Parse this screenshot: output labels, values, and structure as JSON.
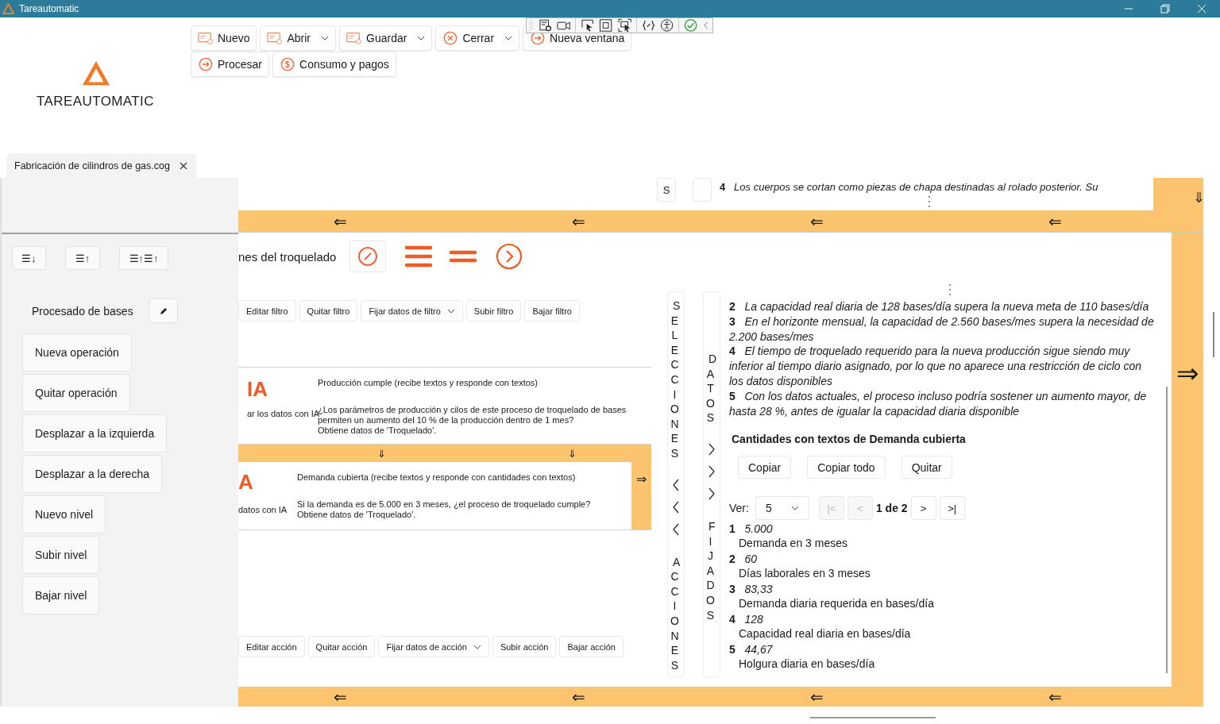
{
  "window": {
    "title": "Tareautomatic"
  },
  "logo": {
    "text": "TAREAUTOMATIC"
  },
  "toolbar": {
    "rows": [
      [
        {
          "label": "Nuevo",
          "dropdown": false
        },
        {
          "label": "Abrir",
          "dropdown": true
        },
        {
          "label": "Guardar",
          "dropdown": true
        },
        {
          "label": "Cerrar",
          "dropdown": true
        },
        {
          "label": "Nueva ventana",
          "dropdown": false
        }
      ],
      [
        {
          "label": "Procesar",
          "dropdown": false
        },
        {
          "label": "Consumo y pagos",
          "dropdown": false
        }
      ]
    ]
  },
  "document_tab": {
    "label": "Fabricación de cilindros de gas.cog"
  },
  "left_panel": {
    "sort_buttons": [
      "☰↓",
      "☰↑",
      "☰↑☰↑"
    ],
    "operation": "Procesado de bases",
    "buttons": [
      "Nueva operación",
      "Quitar operación",
      "Desplazar a la izquierda",
      "Desplazar a la derecha",
      "Nuevo nivel",
      "Subir nivel",
      "Bajar nivel"
    ]
  },
  "canvas": {
    "top_strip": {
      "button": "S",
      "number": "4",
      "text": "Los cuerpos se cortan como piezas de chapa destinadas al rolado posterior. Su",
      "arrow": "⇓"
    },
    "top_band": {
      "arrows": [
        "⇐",
        "⇐",
        "⇐",
        "⇐"
      ]
    },
    "process": {
      "title": "nes del troquelado"
    },
    "filter_buttons": [
      {
        "label": "Editar filtro",
        "dropdown": false
      },
      {
        "label": "Quitar filtro",
        "dropdown": false
      },
      {
        "label": "Fijar datos de filtro",
        "dropdown": true
      },
      {
        "label": "Subir filtro",
        "dropdown": false
      },
      {
        "label": "Bajar filtro",
        "dropdown": false
      }
    ],
    "cards": [
      {
        "badge": "IA",
        "caption": "ar los datos con IA",
        "title": "Producción cumple (recibe textos y responde con textos)",
        "question": "¿Los parámetros de producción y cilos de este proceso de troquelado de bases permiten un aumento del 10 % de la producción dentro de 1 mes?",
        "source": "Obtiene datos de 'Troquelado'."
      },
      {
        "badge": "A",
        "caption": "datos con IA",
        "title": "Demanda cubierta (recibe textos y responde con cantidades con textos)",
        "question": "Si la demanda es de 5.000 en 3 meses, ¿el proceso de troquelado cumple?",
        "source": "Obtiene datos de 'Troquelado'.",
        "side_arrow": "⇒"
      }
    ],
    "card_band": {
      "arrows": [
        "⇓",
        "⇓"
      ]
    },
    "action_buttons": [
      {
        "label": "Editar acción",
        "dropdown": false
      },
      {
        "label": "Quitar acción",
        "dropdown": false
      },
      {
        "label": "Fijar datos de acción",
        "dropdown": true
      },
      {
        "label": "Subir acción",
        "dropdown": false
      },
      {
        "label": "Bajar acción",
        "dropdown": false
      }
    ],
    "selections_strip": {
      "top": "SELECCIONES",
      "bottom": "ACCIONES"
    },
    "data_strip": {
      "top": "DATOS",
      "bottom": "FIJADOS"
    },
    "results": {
      "items": [
        {
          "number": "2",
          "text": "La capacidad real diaria de 128 bases/día supera la nueva meta de 110 bases/día"
        },
        {
          "number": "3",
          "text": "En el horizonte mensual, la capacidad de 2.560 bases/mes supera la necesidad de 2.200 bases/mes"
        },
        {
          "number": "4",
          "text": "El tiempo de troquelado requerido para la nueva producción sigue siendo muy inferior al tiempo diario asignado, por lo que no aparece una restricción de ciclo con los datos disponibles"
        },
        {
          "number": "5",
          "text": "Con los datos actuales, el proceso incluso podría sostener un aumento mayor, de hasta 28 %, antes de igualar la capacidad diaria disponible"
        }
      ],
      "heading": "Cantidades con textos  de Demanda cubierta",
      "buttons": [
        "Copiar",
        "Copiar todo",
        "Quitar"
      ],
      "pager": {
        "label": "Ver:",
        "page_size": "5",
        "page": "1 de 2",
        "buttons": [
          {
            "label": "|<",
            "disabled": true
          },
          {
            "label": "<",
            "disabled": true
          },
          {
            "label": ">",
            "disabled": false
          },
          {
            "label": ">|",
            "disabled": false
          }
        ]
      },
      "quantities": [
        {
          "number": "1",
          "value": "5.000",
          "label": "Demanda en 3 meses"
        },
        {
          "number": "2",
          "value": "60",
          "label": "Días laborales en 3 meses"
        },
        {
          "number": "3",
          "value": "83,33",
          "label": "Demanda diaria requerida en bases/día"
        },
        {
          "number": "4",
          "value": "128",
          "label": "Capacidad real diaria en bases/día"
        },
        {
          "number": "5",
          "value": "44,67",
          "label": "Holgura diaria en bases/día"
        }
      ]
    },
    "side_arrow": "⇒",
    "bottom_band": {
      "arrows": [
        "⇐",
        "⇐",
        "⇐",
        "⇐"
      ]
    }
  }
}
